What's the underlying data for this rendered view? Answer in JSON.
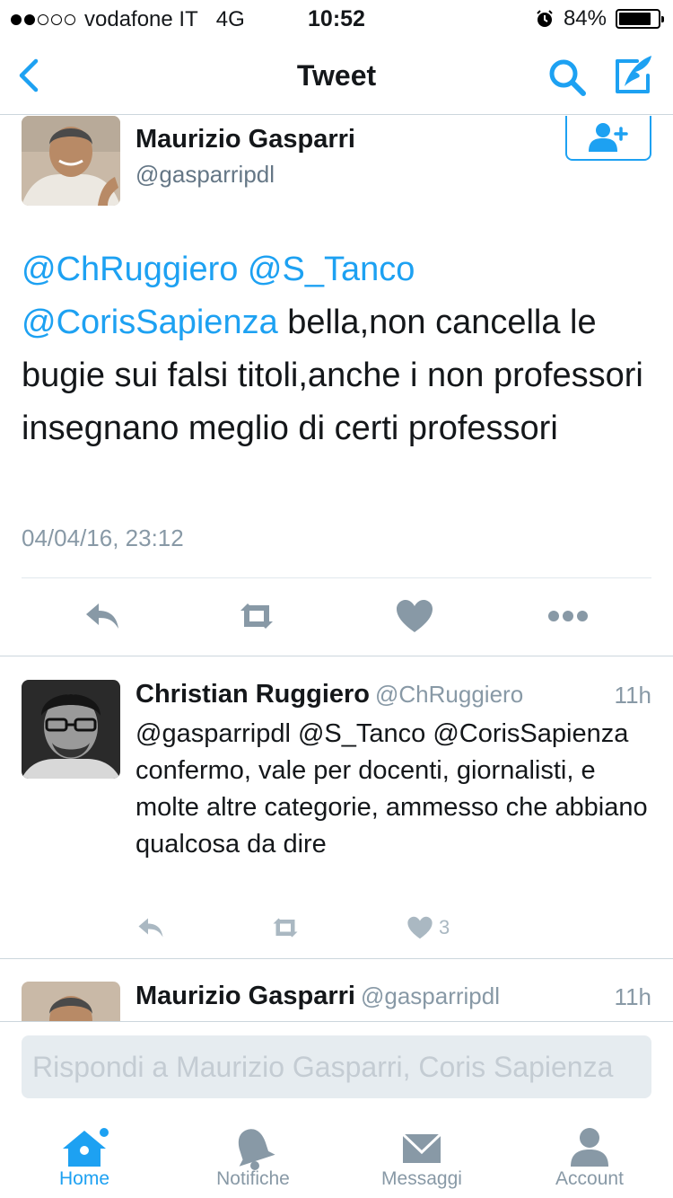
{
  "status_bar": {
    "carrier": "vodafone IT",
    "network": "4G",
    "time": "10:52",
    "battery": "84%",
    "battery_level": 0.84,
    "signal_bars_filled": 2,
    "signal_bars_total": 5
  },
  "nav": {
    "title": "Tweet"
  },
  "tweet": {
    "author_name": "Maurizio Gasparri",
    "author_handle": "@gasparripdl",
    "mentions": [
      "@ChRuggiero",
      "@S_Tanco",
      "@CorisSapienza"
    ],
    "text": " bella,non cancella le bugie sui falsi titoli,anche i non professori insegnano meglio di certi professori",
    "date": "04/04/16, 23:12"
  },
  "replies": [
    {
      "name": "Christian Ruggiero",
      "handle": "@ChRuggiero",
      "time": "11h",
      "text": "@gasparripdl @S_Tanco @CorisSapienza confermo, vale per docenti, giornalisti, e molte altre categorie, ammesso che abbiano qualcosa da dire",
      "likes": "3"
    },
    {
      "name": "Maurizio Gasparri",
      "handle": "@gasparripdl",
      "time": "11h"
    }
  ],
  "composer": {
    "placeholder": "Rispondi a Maurizio Gasparri, Coris Sapienza"
  },
  "tabs": [
    {
      "label": "Home",
      "icon": "home-icon",
      "active": true
    },
    {
      "label": "Notifiche",
      "icon": "bell-icon",
      "active": false
    },
    {
      "label": "Messaggi",
      "icon": "envelope-icon",
      "active": false
    },
    {
      "label": "Account",
      "icon": "person-icon",
      "active": false
    }
  ],
  "colors": {
    "accent": "#1da1f2",
    "secondary_text": "#657786",
    "icon_gray": "#8899a6",
    "divider": "#ccd6dd"
  }
}
